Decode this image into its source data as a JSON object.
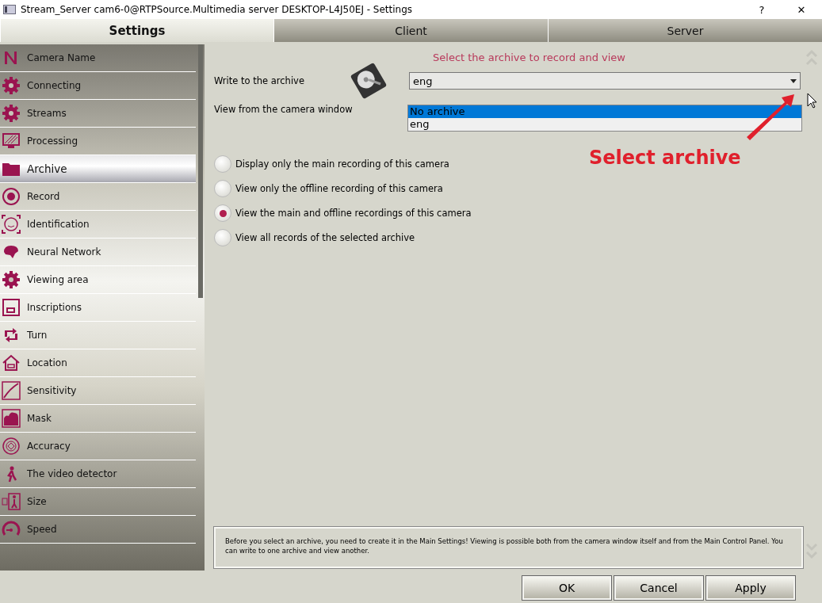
{
  "window": {
    "title": "Stream_Server cam6-0@RTPSource.Multimedia server DESKTOP-L4J50EJ - Settings",
    "help": "?",
    "close": "✕"
  },
  "tabs": [
    {
      "label": "Settings",
      "selected": true
    },
    {
      "label": "Client",
      "selected": false
    },
    {
      "label": "Server",
      "selected": false
    }
  ],
  "sidebar": {
    "items": [
      {
        "label": "Camera Name",
        "selected": false
      },
      {
        "label": "Connecting",
        "selected": false
      },
      {
        "label": "Streams",
        "selected": false
      },
      {
        "label": "Processing",
        "selected": false
      },
      {
        "label": "Archive",
        "selected": true
      },
      {
        "label": "Record",
        "selected": false
      },
      {
        "label": "Identification",
        "selected": false
      },
      {
        "label": "Neural Network",
        "selected": false
      },
      {
        "label": "Viewing area",
        "selected": false
      },
      {
        "label": "Inscriptions",
        "selected": false
      },
      {
        "label": "Turn",
        "selected": false
      },
      {
        "label": "Location",
        "selected": false
      },
      {
        "label": "Sensitivity",
        "selected": false
      },
      {
        "label": "Mask",
        "selected": false
      },
      {
        "label": "Accuracy",
        "selected": false
      },
      {
        "label": "The video detector",
        "selected": false
      },
      {
        "label": "Size",
        "selected": false
      },
      {
        "label": "Speed",
        "selected": false
      }
    ]
  },
  "content": {
    "heading": "Select the archive to record and view",
    "write_label": "Write to the archive",
    "write_value": "eng",
    "view_label": "View from the camera window",
    "dropdown_options": [
      {
        "label": "No archive",
        "selected": true
      },
      {
        "label": "eng",
        "selected": false
      }
    ],
    "annotation": "Select archive",
    "radios": [
      {
        "label": "Display only the main recording of this camera",
        "selected": false
      },
      {
        "label": "View only the offline recording of this camera",
        "selected": false
      },
      {
        "label": "View the main and offline recordings of this camera",
        "selected": true
      },
      {
        "label": "View all records of the selected archive",
        "selected": false
      }
    ],
    "info": "Before you select an archive, you need to create it in the Main Settings! Viewing is possible both from the camera window itself and from the Main Control Panel. You can write to one archive and view another."
  },
  "buttons": [
    "OK",
    "Cancel",
    "Apply"
  ]
}
